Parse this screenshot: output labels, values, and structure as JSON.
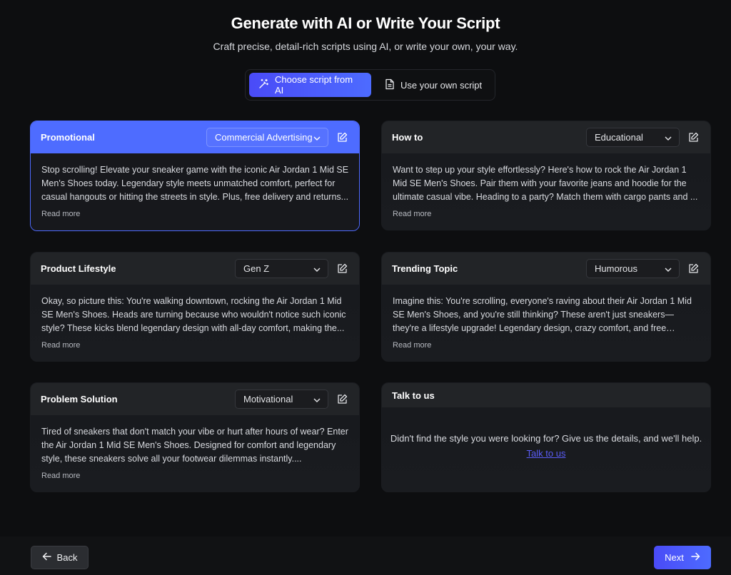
{
  "header": {
    "title": "Generate with AI or Write Your Script",
    "subtitle": "Craft precise, detail-rich scripts using AI, or write your own, your way."
  },
  "mode_switch": {
    "ai_label": "Choose script from AI",
    "own_label": "Use your own script",
    "selected": "ai"
  },
  "cards": [
    {
      "title": "Promotional",
      "tone": "Commercial Advertising",
      "text": "Stop scrolling! Elevate your sneaker game with the iconic Air Jordan 1 Mid SE Men's Shoes today. Legendary style meets unmatched comfort, perfect for casual hangouts or hitting the streets in style. Plus, free delivery and returns...",
      "read_more": "Read more",
      "selected": true
    },
    {
      "title": "How to",
      "tone": "Educational",
      "text": "Want to step up your style effortlessly? Here's how to rock the Air Jordan 1 Mid SE Men's Shoes. Pair them with your favorite jeans and hoodie for the ultimate casual vibe. Heading to a party? Match them with cargo pants and ...",
      "read_more": "Read more",
      "selected": false
    },
    {
      "title": "Product Lifestyle",
      "tone": "Gen Z",
      "text": "Okay, so picture this: You're walking downtown, rocking the Air Jordan 1 Mid SE Men's Shoes. Heads are turning because who wouldn't notice such iconic style? These kicks blend legendary design with all-day comfort, making the...",
      "read_more": "Read more",
      "selected": false
    },
    {
      "title": "Trending Topic",
      "tone": "Humorous",
      "text": "Imagine this: You're scrolling, everyone's raving about their Air Jordan 1 Mid SE Men's Shoes, and you're still thinking? These aren't just sneakers—they're a lifestyle upgrade! Legendary design, crazy comfort, and free delivery? It's...",
      "read_more": "Read more",
      "selected": false
    },
    {
      "title": "Problem Solution",
      "tone": "Motivational",
      "text": "Tired of sneakers that don't match your vibe or hurt after hours of wear? Enter the Air Jordan 1 Mid SE Men's Shoes. Designed for comfort and legendary style, these sneakers solve all your footwear dilemmas instantly....",
      "read_more": "Read more",
      "selected": false
    }
  ],
  "talk_card": {
    "title": "Talk to us",
    "text": "Didn't find the style you were looking for? Give us the details, and we'll help.",
    "link": "Talk to us"
  },
  "footer": {
    "back_label": "Back",
    "next_label": "Next"
  },
  "colors": {
    "accent": "#4e6cff",
    "background": "#0d0e10",
    "card": "#1a1c20",
    "link": "#5a5cf5"
  }
}
